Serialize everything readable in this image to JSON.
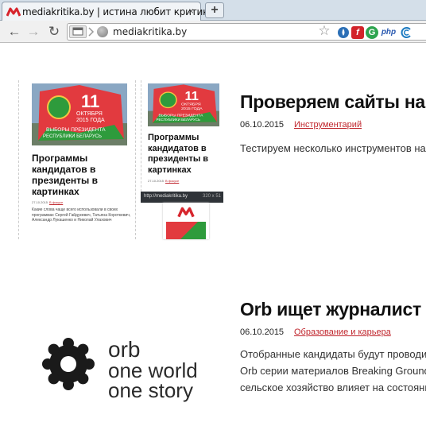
{
  "browser": {
    "tab_title": "mediakritika.by | истина любит критику",
    "tab_close_label": "×",
    "new_tab_label": "+",
    "url": "mediakritika.by",
    "nav": {
      "back": "←",
      "forward": "→",
      "reload": "↻"
    },
    "extensions": [
      {
        "name": "star-icon",
        "glyph": "☆"
      },
      {
        "name": "drop-icon",
        "glyph": ""
      },
      {
        "name": "f-extension-icon",
        "glyph": "f"
      },
      {
        "name": "g-extension-icon",
        "glyph": "G"
      },
      {
        "name": "php-icon",
        "glyph": "php"
      },
      {
        "name": "wave-icon",
        "glyph": ""
      }
    ]
  },
  "articles": [
    {
      "title": "Проверяем сайты на",
      "date": "06.10.2015",
      "category": "Инструментарий",
      "excerpt": [
        "Тестируем несколько инструментов на"
      ],
      "thumbnail": {
        "card_title": "Программы кандидатов в президенты в картинках",
        "card_date": "27.10.2015",
        "card_link": "В фокусе",
        "card_text": "Какие слова чаще всего использовали в своих программах Сергей Гайдукевич, Татьяна Короткевич, Александр Лукашенко и Николай Улахович",
        "poster_line1": "11",
        "poster_line2": "ОКТЯБРЯ",
        "poster_line3": "2015 ГОДА",
        "poster_line4": "ВЫБОРЫ ПРЕЗИДЕНТА",
        "poster_line5": "РЕСПУБЛИКИ БЕЛАРУСЬ",
        "mobile_url": "http://mediakritika.by",
        "mobile_size": "320 x 51"
      }
    },
    {
      "title": "Orb ищет журналист",
      "date": "06.10.2015",
      "category": "Образование и карьера",
      "excerpt": [
        "Отобранные кандидаты будут проводит",
        "Orb серии материалов Breaking Ground",
        "сельское хозяйство влияет на состояни"
      ],
      "thumbnail": {
        "logo_line1": "orb",
        "logo_line2": "one world",
        "logo_line3": "one story"
      }
    }
  ],
  "colors": {
    "accent_red": "#c0262d",
    "poster_red": "#e23a3f",
    "poster_green": "#2e9b3c"
  }
}
